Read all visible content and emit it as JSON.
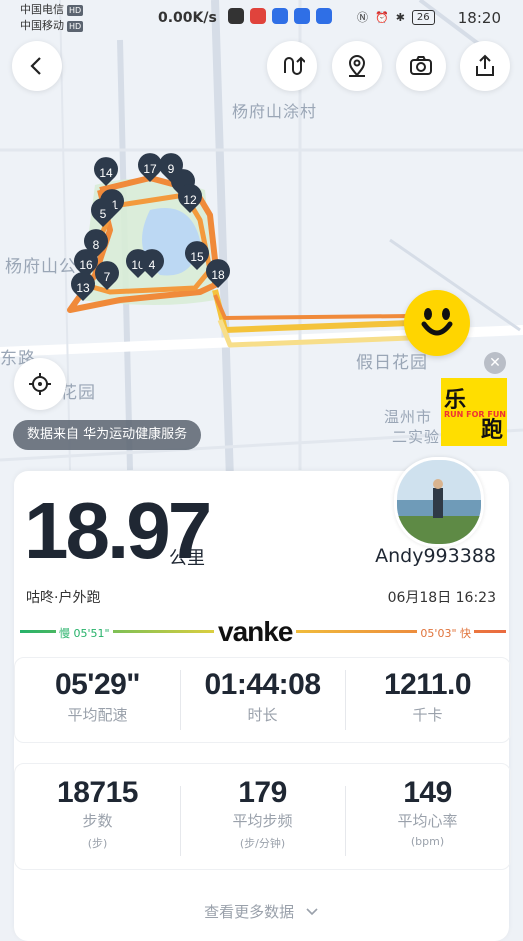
{
  "status_bar": {
    "carrier1": "中国电信",
    "carrier2": "中国移动",
    "hd": "HD",
    "speed": "0.00K/s",
    "battery": "26",
    "time": "18:20"
  },
  "map": {
    "labels": {
      "village": "杨府山涂村",
      "shan": "杨府山公",
      "road": "东路",
      "garden_left": "花园",
      "holiday_garden": "假日花园",
      "wenzhou": "温州市",
      "school": "二实验"
    },
    "markers": [
      "14",
      "17",
      "9",
      "11",
      "5",
      "12",
      "8",
      "16",
      "7",
      "10",
      "4",
      "13",
      "15",
      "18"
    ],
    "route_colors": {
      "orange": "#f08a3a",
      "yellow": "#f4c33b",
      "pale": "#f7de8a"
    }
  },
  "data_source": "数据来自 华为运动健康服务",
  "badge": {
    "cn1": "乐",
    "cn2": "跑",
    "en": "RUN FOR FUN"
  },
  "summary": {
    "distance": "18.97",
    "distance_unit": "公里",
    "username": "Andy993388",
    "source": "咕咚·户外跑",
    "datetime": "06月18日 16:23",
    "pace_slow": "慢 05'51\"",
    "pace_fast": "05'03\" 快",
    "sponsor": "vanke"
  },
  "stats_row1": [
    {
      "value": "05'29\"",
      "label": "平均配速"
    },
    {
      "value": "01:44:08",
      "label": "时长"
    },
    {
      "value": "1211.0",
      "label": "千卡"
    }
  ],
  "stats_row2": [
    {
      "value": "18715",
      "label": "步数",
      "sub": "(步)"
    },
    {
      "value": "179",
      "label": "平均步频",
      "sub": "(步/分钟)"
    },
    {
      "value": "149",
      "label": "平均心率",
      "sub": "(bpm)"
    }
  ],
  "more_label": "查看更多数据"
}
